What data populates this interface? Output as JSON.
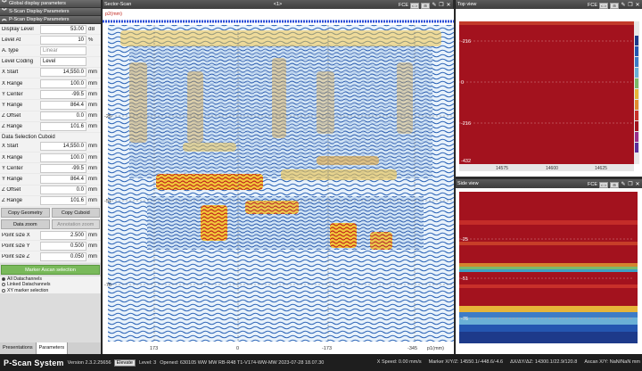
{
  "left_panel": {
    "sections": {
      "global": "Global display parameters",
      "sscan": "S-Scan Display Parameters",
      "pscan": "P-Scan Display Parameters"
    },
    "params": [
      {
        "label": "Display Level",
        "value": "53.00",
        "unit": "dB"
      },
      {
        "label": "Level At",
        "value": "10",
        "unit": "%"
      },
      {
        "label": "A. type",
        "value": "Linear",
        "unit": ""
      },
      {
        "label": "Level Coding",
        "value": "Level",
        "unit": ""
      },
      {
        "label": "X Start",
        "value": "14,550.0",
        "unit": "mm"
      },
      {
        "label": "X Range",
        "value": "100.0",
        "unit": "mm"
      },
      {
        "label": "Y Center",
        "value": "-99.5",
        "unit": "mm"
      },
      {
        "label": "Y Range",
        "value": "864.4",
        "unit": "mm"
      },
      {
        "label": "Z Offset",
        "value": "0.0",
        "unit": "mm"
      },
      {
        "label": "Z Range",
        "value": "101.6",
        "unit": "mm"
      }
    ],
    "cuboid_title": "Data Selection Cuboid",
    "cuboid": [
      {
        "label": "X Start",
        "value": "14,550.0",
        "unit": "mm"
      },
      {
        "label": "X Range",
        "value": "100.0",
        "unit": "mm"
      },
      {
        "label": "Y Center",
        "value": "-99.5",
        "unit": "mm"
      },
      {
        "label": "Y Range",
        "value": "864.4",
        "unit": "mm"
      },
      {
        "label": "Z Offset",
        "value": "0.0",
        "unit": "mm"
      },
      {
        "label": "Z Range",
        "value": "101.6",
        "unit": "mm"
      }
    ],
    "buttons": {
      "copy_geometry": "Copy Geometry",
      "copy_cuboid": "Copy Cuboid",
      "data_zoom": "Data zoom",
      "annotation_zoom": "Annotation zoom",
      "marker_ascan": "Marker Ascan selection"
    },
    "point_sizes": [
      {
        "label": "Point size X",
        "value": "2.500",
        "unit": "mm"
      },
      {
        "label": "Point size Y",
        "value": "0.500",
        "unit": "mm"
      },
      {
        "label": "Point size Z",
        "value": "0.050",
        "unit": "mm"
      }
    ],
    "radios": [
      "All Datachannels",
      "Linked Datachannels",
      "XY marker selection"
    ],
    "tabs": [
      "Presentations",
      "Parameters"
    ]
  },
  "sector": {
    "title": "Sector-Scan",
    "marker": "<1>",
    "fce": "FCE",
    "unit_tag": "p2(mm)",
    "y_ticks": [
      "-25",
      "-51",
      "-76"
    ],
    "x_ticks": [
      "173",
      "0",
      "-173",
      "-345"
    ],
    "x_unit": "p1(mm)"
  },
  "top_view": {
    "title": "Top view",
    "fce": "FCE",
    "y_ticks": [
      "-216",
      "0",
      "-216",
      "-432"
    ],
    "x_ticks": [
      "14575",
      "14600",
      "14625"
    ]
  },
  "side_view": {
    "title": "Side view",
    "fce": "FCE",
    "y_ticks": [
      "-25",
      "-51",
      "-76"
    ],
    "x_ticks": [
      "14575",
      "14600",
      "14625"
    ]
  },
  "status": {
    "brand": "P-Scan System",
    "version": "Version 2.3.2.25656",
    "elevate": "Elevate",
    "level": "Level: 3",
    "opened": "Opened: 630105 WW MW RB-R48 T1-V174-WW-MW 2023-07-28 18.07.30",
    "speed": "X Speed: 0.00 mm/s",
    "marker": "Marker X/Y/Z: 14550.1/-448.6/-4.6",
    "delta": "ΔX/ΔY/ΔZ: 14300.1/22.9/120.8",
    "ascan": "Ascan X/Y: NaN/NaN mm"
  },
  "colors": {
    "panel_red": "#a3121e",
    "accent_green": "#79b95a",
    "status_bg": "#1e1e1e"
  }
}
